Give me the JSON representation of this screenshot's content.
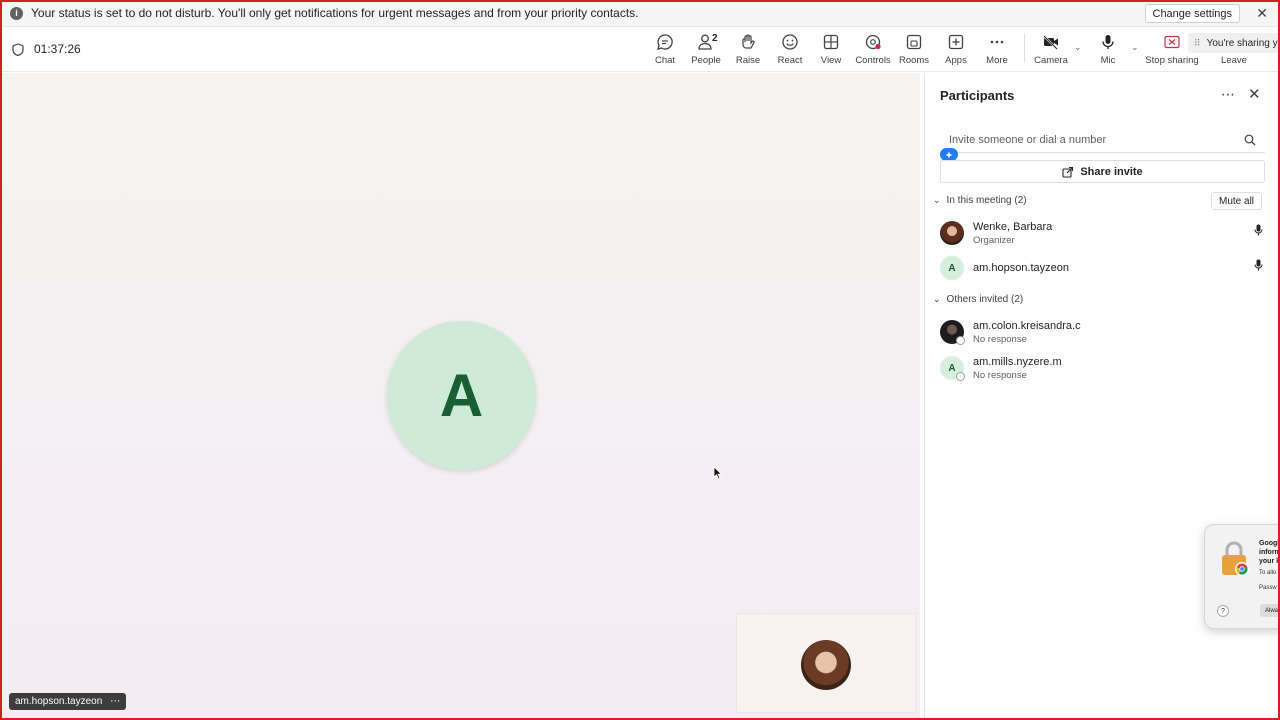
{
  "notification": {
    "message": "Your status is set to do not disturb. You'll only get notifications for urgent messages and from your priority contacts.",
    "change_settings": "Change settings"
  },
  "meeting": {
    "timer": "01:37:26"
  },
  "toolbar": {
    "chat": "Chat",
    "people": "People",
    "people_count": "2",
    "raise": "Raise",
    "react": "React",
    "view": "View",
    "controls": "Controls",
    "rooms": "Rooms",
    "apps": "Apps",
    "more": "More",
    "camera": "Camera",
    "mic": "Mic",
    "stop_sharing": "Stop sharing",
    "leave": "Leave",
    "sharing_banner": "You're sharing yo"
  },
  "stage": {
    "avatar_letter": "A",
    "name_chip": "am.hopson.tayzeon"
  },
  "panel": {
    "title": "Participants",
    "invite_placeholder": "Invite someone or dial a number",
    "share_invite": "Share invite",
    "in_meeting_label": "In this meeting (2)",
    "mute_all": "Mute all",
    "others_label": "Others invited (2)",
    "in_meeting": [
      {
        "name": "Wenke, Barbara",
        "sub": "Organizer",
        "avatar": "photo"
      },
      {
        "name": "am.hopson.tayzeon",
        "sub": "",
        "avatar": "A"
      }
    ],
    "others": [
      {
        "name": "am.colon.kreisandra.c",
        "sub": "No response",
        "avatar": "photo"
      },
      {
        "name": "am.mills.nyzere.m",
        "sub": "No response",
        "avatar": "A"
      }
    ]
  },
  "popup": {
    "title": "Google Chrome wants to access information in your keychain.",
    "title_visible": "Googl\ninform\nyour k",
    "line1": "To allo",
    "line2": "Passw",
    "help": "?",
    "button": "Alwa"
  },
  "colors": {
    "accent": "#5b5fc7",
    "leave_red": "#c4314b",
    "avatar_green": "#cdebd6",
    "avatar_text": "#1a5e35",
    "frame_red": "#d91e1e"
  }
}
